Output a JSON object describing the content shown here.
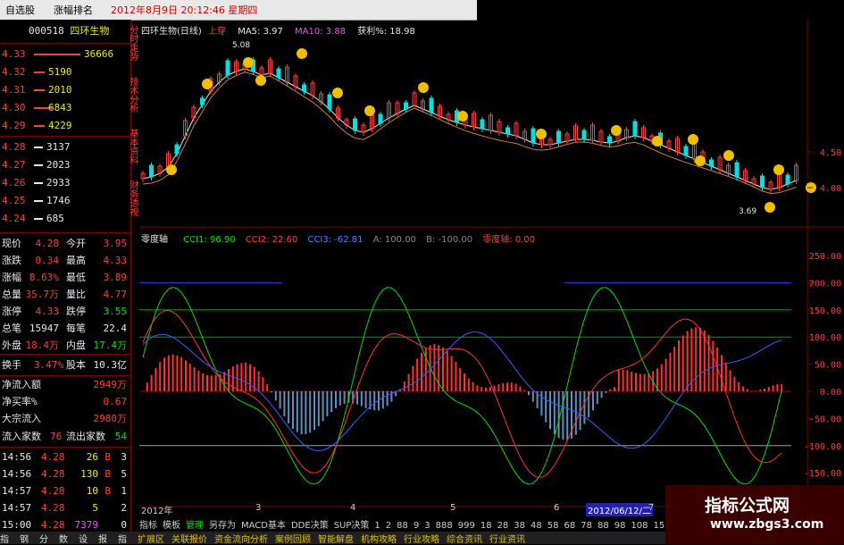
{
  "topbar": {
    "tab1": "自选股",
    "tab2": "涨幅排名",
    "datetime": "2012年8月9日  20:12:46 星期四"
  },
  "stock": {
    "code": "000518",
    "name": "四环生物"
  },
  "asks": [
    {
      "price": "4.33",
      "vol": "36666"
    },
    {
      "price": "4.32",
      "vol": "5190"
    },
    {
      "price": "4.31",
      "vol": "2010"
    },
    {
      "price": "4.30",
      "vol": "6843"
    },
    {
      "price": "4.29",
      "vol": "4229"
    }
  ],
  "bids": [
    {
      "price": "4.28",
      "vol": "3137"
    },
    {
      "price": "4.27",
      "vol": "2023"
    },
    {
      "price": "4.26",
      "vol": "2933"
    },
    {
      "price": "4.25",
      "vol": "1746"
    },
    {
      "price": "4.24",
      "vol": "685"
    }
  ],
  "quote": [
    [
      "现价",
      "4.28",
      "今开",
      "3.95"
    ],
    [
      "涨跌",
      "0.34",
      "最高",
      "4.33"
    ],
    [
      "涨幅",
      "8.63%",
      "最低",
      "3.89"
    ],
    [
      "总量",
      "35.7万",
      "量比",
      "4.77"
    ],
    [
      "涨停",
      "4.33",
      "跌停",
      "3.55"
    ],
    [
      "总笔",
      "15947",
      "每笔",
      "22.4"
    ],
    [
      "外盘",
      "18.4万",
      "内盘",
      "17.4万"
    ]
  ],
  "turnover": {
    "label1": "换手",
    "val1": "3.47%",
    "label2": "股本",
    "val2": "10.3亿"
  },
  "flows": [
    [
      "净流入额",
      "2949万"
    ],
    [
      "净买率%",
      "0.67"
    ],
    [
      "大宗流入",
      "2980万"
    ]
  ],
  "inflow_count": {
    "label1": "流入家数",
    "val1": "76",
    "label2": "流出家数",
    "val2": "54"
  },
  "ticks": [
    [
      "14:56",
      "4.28",
      "26",
      "B",
      "3"
    ],
    [
      "14:56",
      "4.28",
      "130",
      "B",
      "5"
    ],
    [
      "14:57",
      "4.28",
      "10",
      "B",
      "1"
    ],
    [
      "14:57",
      "4.28",
      "5",
      "",
      "2"
    ],
    [
      "15:00",
      "4.28",
      "7379",
      "",
      "0"
    ]
  ],
  "vtabs": [
    "分时走势",
    "技术分析",
    "基本资料",
    "财务透视"
  ],
  "price_legend": {
    "title": "四环生物(日线)",
    "signal": "上穿",
    "ma5": "MA5: 3.97",
    "ma10": "MA10: 3.88",
    "gain": "获利%: 18.98"
  },
  "price_labels": {
    "high": "5.08",
    "low": "3.69"
  },
  "price_axis": [
    "4.50",
    "4.00"
  ],
  "cci_legend": {
    "name": "零度轴",
    "cci1": "CCI1: 96.90",
    "cci2": "CCI2: 22.60",
    "cci3": "CCI3: -62.81",
    "a": "A: 100.00",
    "b": "B: -100.00",
    "zero": "零度轴: 0.00"
  },
  "cci_axis": [
    "250.00",
    "200.00",
    "150.00",
    "100.00",
    "50.00",
    "0.00",
    "-50.00",
    "-100.00",
    "-150.00",
    "-200.00"
  ],
  "date_axis": {
    "year": "2012年",
    "m3": "3",
    "m4": "4",
    "m5": "5",
    "m6": "6",
    "hl": "2012/06/12/二",
    "m7": "7"
  },
  "tabs": [
    "指标",
    "模板",
    "管理",
    "另存为",
    "MACD基本",
    "DDE决策",
    "SUP决策",
    "1",
    "2",
    "88",
    "9",
    "3",
    "888",
    "999",
    "18",
    "28",
    "38",
    "48",
    "58",
    "68",
    "78",
    "88",
    "98",
    "108",
    "158",
    "168",
    "178"
  ],
  "footer": [
    "指",
    "钢",
    "分",
    "数",
    "设",
    "报",
    "指",
    "扩展区",
    "关联报价",
    "资金流向分析",
    "案例回顾",
    "智能解盘",
    "机构攻略",
    "行业攻略",
    "综合资讯",
    "行业资讯"
  ],
  "watermark": {
    "line1": "指标公式网",
    "line2": "www.zbgs3.com"
  },
  "colors": {
    "up": "#ff3b3b",
    "down": "#00e0e0",
    "cci1": "#00e000",
    "cci2": "#ff3030",
    "cci3": "#3060ff"
  }
}
